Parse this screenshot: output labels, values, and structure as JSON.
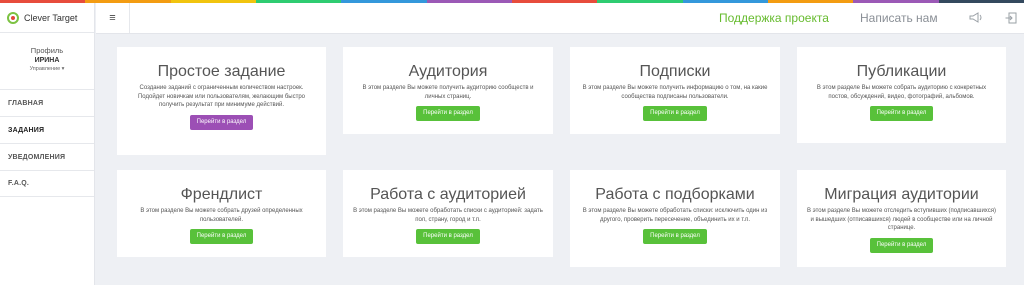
{
  "colors": {
    "stripe": [
      "#e74c3c",
      "#f39c12",
      "#f1c40f",
      "#2ecc71",
      "#3498db",
      "#9b59b6",
      "#e74c3c",
      "#2ecc71",
      "#3498db",
      "#f39c12",
      "#9b59b6",
      "#34495e"
    ],
    "accent_green": "#58c13a",
    "accent_purple": "#9c4fb5"
  },
  "app": {
    "brand": "Clever Target"
  },
  "profile": {
    "label": "Профиль",
    "name": "ИРИНА",
    "manage": "Управление ▾"
  },
  "nav": {
    "items": [
      {
        "label": "ГЛАВНАЯ"
      },
      {
        "label": "ЗАДАНИЯ"
      },
      {
        "label": "УВЕДОМЛЕНИЯ"
      },
      {
        "label": "F.A.Q."
      }
    ]
  },
  "header": {
    "menu_icon": "≡",
    "support": "Поддержка проекта",
    "write": "Написать нам",
    "icons": [
      "megaphone-icon",
      "logout-icon"
    ]
  },
  "cards": [
    {
      "title": "Простое задание",
      "text": "Создание заданий с ограниченным количеством настроек. Подойдет новичкам или пользователям, желающим быстро получить результат при минимуме действий.",
      "button": "Перейти в раздел"
    },
    {
      "title": "Аудитория",
      "text": "В этом разделе Вы можете получить аудиторию сообществ и личных страниц.",
      "button": "Перейти в раздел"
    },
    {
      "title": "Подписки",
      "text": "В этом разделе Вы можете получить информацию о том, на какие сообщества подписаны пользователи.",
      "button": "Перейти в раздел"
    },
    {
      "title": "Публикации",
      "text": "В этом разделе Вы можете собрать аудиторию с конкретных постов, обсуждений, видео, фотографий, альбомов.",
      "button": "Перейти в раздел"
    },
    {
      "title": "Френдлист",
      "text": "В этом разделе Вы можете собрать друзей определенных пользователей.",
      "button": "Перейти в раздел"
    },
    {
      "title": "Работа с аудиторией",
      "text": "В этом разделе Вы можете обработать списки с аудиторией: задать пол, страну, город и т.п.",
      "button": "Перейти в раздел"
    },
    {
      "title": "Работа с подборками",
      "text": "В этом разделе Вы можете обработать списки: исключить один из другого, проверить пересечение, объединить их и т.п.",
      "button": "Перейти в раздел"
    },
    {
      "title": "Миграция аудитории",
      "text": "В этом разделе Вы можете отследить вступивших (подписавшихся) и вышедших (отписавшихся) людей в сообществе или на личной странице.",
      "button": "Перейти в раздел"
    }
  ]
}
